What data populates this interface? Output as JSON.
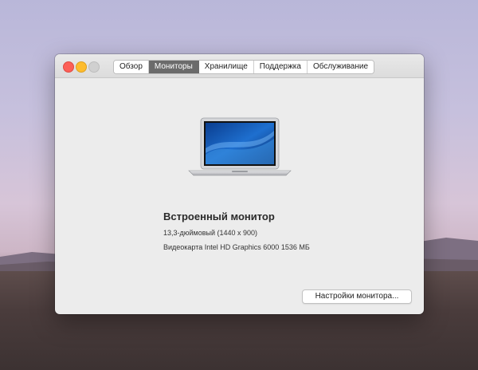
{
  "window": {
    "tabs": [
      {
        "label": "Обзор"
      },
      {
        "label": "Мониторы"
      },
      {
        "label": "Хранилище"
      },
      {
        "label": "Поддержка"
      },
      {
        "label": "Обслуживание"
      }
    ],
    "active_tab": "Мониторы"
  },
  "display": {
    "title": "Встроенный монитор",
    "size": "13,3-дюймовый (1440 x 900)",
    "graphics": "Видеокарта Intel HD Graphics 6000 1536 МБ"
  },
  "actions": {
    "settings_button": "Настройки монитора..."
  },
  "colors": {
    "close": "#fc5f57",
    "minimize": "#fdbc2e",
    "zoom_disabled": "#d0d0d0",
    "active_tab": "#6b6b6b"
  }
}
